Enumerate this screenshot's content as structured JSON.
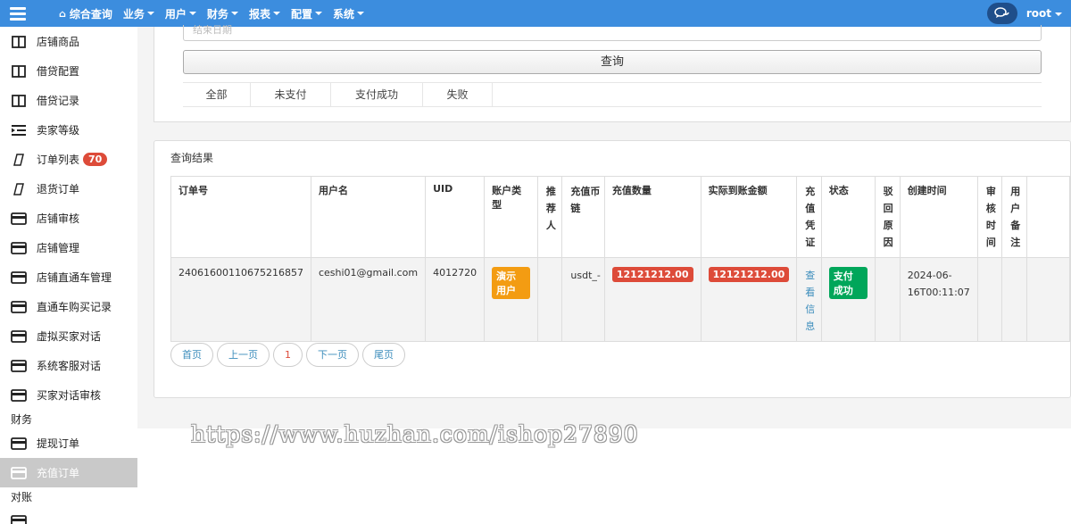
{
  "topbar": {
    "nav": [
      {
        "label": "综合查询",
        "icon": "home-icon",
        "dropdown": false
      },
      {
        "label": "业务",
        "dropdown": true
      },
      {
        "label": "用户",
        "dropdown": true
      },
      {
        "label": "财务",
        "dropdown": true
      },
      {
        "label": "报表",
        "dropdown": true
      },
      {
        "label": "配置",
        "dropdown": true
      },
      {
        "label": "系统",
        "dropdown": true
      }
    ],
    "user": "root",
    "accent": "#3c8dde"
  },
  "sidebar": {
    "items": [
      {
        "label": "店铺商品",
        "icon": "columns-icon"
      },
      {
        "label": "借贷配置",
        "icon": "columns-icon"
      },
      {
        "label": "借贷记录",
        "icon": "columns-icon"
      },
      {
        "label": "卖家等级",
        "icon": "indent-icon"
      },
      {
        "label": "订单列表",
        "icon": "file-icon",
        "badge": "70"
      },
      {
        "label": "退货订单",
        "icon": "file-icon"
      },
      {
        "label": "店铺审核",
        "icon": "credit-card-icon"
      },
      {
        "label": "店铺管理",
        "icon": "credit-card-icon"
      },
      {
        "label": "店铺直通车管理",
        "icon": "credit-card-icon"
      },
      {
        "label": "直通车购买记录",
        "icon": "credit-card-icon"
      },
      {
        "label": "虚拟买家对话",
        "icon": "credit-card-icon"
      },
      {
        "label": "系统客服对话",
        "icon": "credit-card-icon"
      },
      {
        "label": "买家对话审核",
        "icon": "credit-card-icon"
      }
    ],
    "group_finance": "财务",
    "finance_items": [
      {
        "label": "提现订单",
        "icon": "credit-card-icon",
        "active": false
      },
      {
        "label": "充值订单",
        "icon": "credit-card-icon",
        "active": true
      }
    ],
    "group_reconcile": "对账"
  },
  "filter": {
    "date_placeholder": "结束日期",
    "query_button": "查询",
    "tabs": [
      "全部",
      "未支付",
      "支付成功",
      "失败"
    ]
  },
  "results": {
    "title": "查询结果",
    "columns": [
      "订单号",
      "用户名",
      "UID",
      "账户类型",
      "推荐人",
      "充值币链",
      "充值数量",
      "实际到账金额",
      "充值凭证",
      "状态",
      "驳回原因",
      "创建时间",
      "审核时间",
      "用户备注",
      ""
    ],
    "row": {
      "order_no": "24061600110675216857",
      "username": "ceshi01@gmail.com",
      "uid": "4012720",
      "account_type": "演示用户",
      "referrer": "",
      "chain": "usdt_-",
      "amount": "12121212.00",
      "actual_amount": "12121212.00",
      "voucher_link": "查看信息",
      "status": "支付成功",
      "reject_reason": "",
      "created_at": "2024-06-16T00:11:07",
      "reviewed_at": "",
      "user_note": ""
    }
  },
  "pagination": {
    "first": "首页",
    "prev": "上一页",
    "current": "1",
    "next": "下一页",
    "last": "尾页"
  },
  "watermark": "https://www.huzhan.com/ishop27890"
}
